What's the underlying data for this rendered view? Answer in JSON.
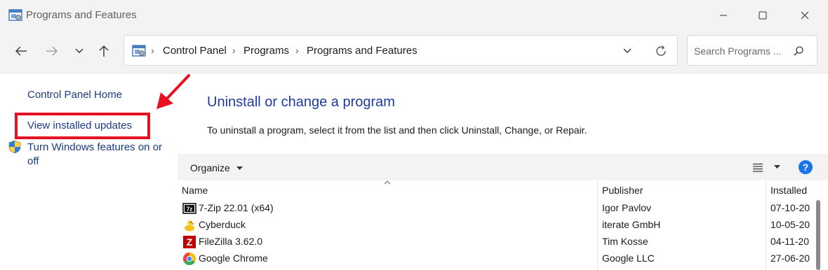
{
  "window": {
    "title": "Programs and Features"
  },
  "address": {
    "crumbs": [
      "Control Panel",
      "Programs",
      "Programs and Features"
    ]
  },
  "search": {
    "placeholder": "Search Programs ..."
  },
  "sidebar": {
    "home": "Control Panel Home",
    "view_updates": "View installed updates",
    "windows_features_line1": "Turn Windows features on or",
    "windows_features_line2": "off"
  },
  "main": {
    "heading": "Uninstall or change a program",
    "description": "To uninstall a program, select it from the list and then click Uninstall, Change, or Repair."
  },
  "toolbar": {
    "organize": "Organize",
    "help": "?"
  },
  "columns": {
    "name": "Name",
    "publisher": "Publisher",
    "installed": "Installed"
  },
  "programs": [
    {
      "name": "7-Zip 22.01 (x64)",
      "publisher": "Igor Pavlov",
      "installed": "07-10-20",
      "icon": "7zip-icon"
    },
    {
      "name": "Cyberduck",
      "publisher": "iterate GmbH",
      "installed": "10-05-20",
      "icon": "cyberduck-icon"
    },
    {
      "name": "FileZilla 3.62.0",
      "publisher": "Tim Kosse",
      "installed": "04-11-20",
      "icon": "filezilla-icon"
    },
    {
      "name": "Google Chrome",
      "publisher": "Google LLC",
      "installed": "27-06-20",
      "icon": "chrome-icon"
    }
  ],
  "colors": {
    "highlight_box": "#e81123",
    "arrow": "#e81123",
    "link": "#1a3b85",
    "heading": "#1e3c9c",
    "help": "#1a73e8"
  }
}
